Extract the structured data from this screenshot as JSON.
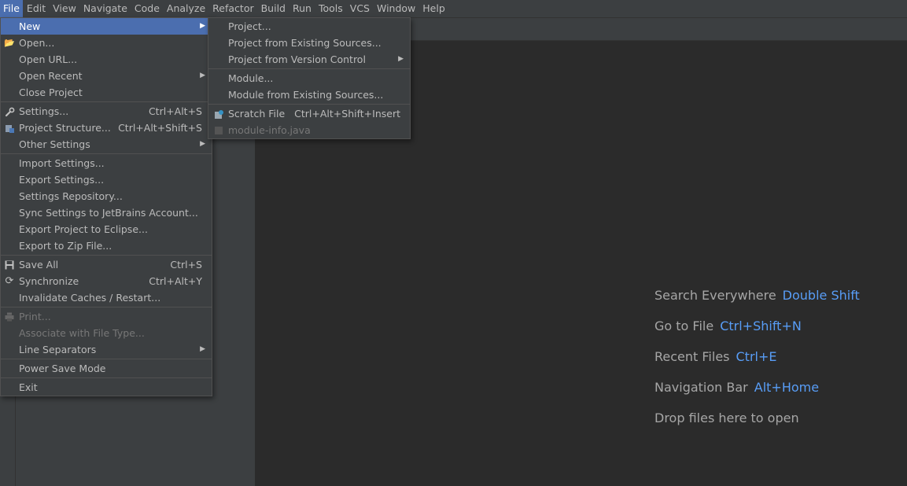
{
  "menubar": {
    "items": [
      {
        "label": "File"
      },
      {
        "label": "Edit"
      },
      {
        "label": "View"
      },
      {
        "label": "Navigate"
      },
      {
        "label": "Code"
      },
      {
        "label": "Analyze"
      },
      {
        "label": "Refactor"
      },
      {
        "label": "Build"
      },
      {
        "label": "Run"
      },
      {
        "label": "Tools"
      },
      {
        "label": "VCS"
      },
      {
        "label": "Window"
      },
      {
        "label": "Help"
      }
    ]
  },
  "file_menu": {
    "new": "New",
    "open": "Open...",
    "open_url": "Open URL...",
    "open_recent": "Open Recent",
    "close_project": "Close Project",
    "settings": "Settings...",
    "settings_sc": "Ctrl+Alt+S",
    "project_structure": "Project Structure...",
    "project_structure_sc": "Ctrl+Alt+Shift+S",
    "other_settings": "Other Settings",
    "import_settings": "Import Settings...",
    "export_settings": "Export Settings...",
    "settings_repository": "Settings Repository...",
    "sync_settings": "Sync Settings to JetBrains Account...",
    "export_eclipse": "Export Project to Eclipse...",
    "export_zip": "Export to Zip File...",
    "save_all": "Save All",
    "save_all_sc": "Ctrl+S",
    "synchronize": "Synchronize",
    "synchronize_sc": "Ctrl+Alt+Y",
    "invalidate_caches": "Invalidate Caches / Restart...",
    "print": "Print...",
    "associate": "Associate with File Type...",
    "line_separators": "Line Separators",
    "power_save": "Power Save Mode",
    "exit": "Exit"
  },
  "new_menu": {
    "project": "Project...",
    "project_existing": "Project from Existing Sources...",
    "project_vcs": "Project from Version Control",
    "module": "Module...",
    "module_existing": "Module from Existing Sources...",
    "scratch_file": "Scratch File",
    "scratch_file_sc": "Ctrl+Alt+Shift+Insert",
    "module_info": "module-info.java"
  },
  "editor_hints": {
    "search_everywhere": "Search Everywhere",
    "search_everywhere_key": "Double Shift",
    "go_to_file": "Go to File",
    "go_to_file_key": "Ctrl+Shift+N",
    "recent_files": "Recent Files",
    "recent_files_key": "Ctrl+E",
    "navigation_bar": "Navigation Bar",
    "navigation_bar_key": "Alt+Home",
    "drop_files": "Drop files here to open"
  },
  "colors": {
    "background": "#2b2b2b",
    "panel": "#3c3f41",
    "selection": "#4b6eaf",
    "shortcut_accent": "#589df6"
  }
}
